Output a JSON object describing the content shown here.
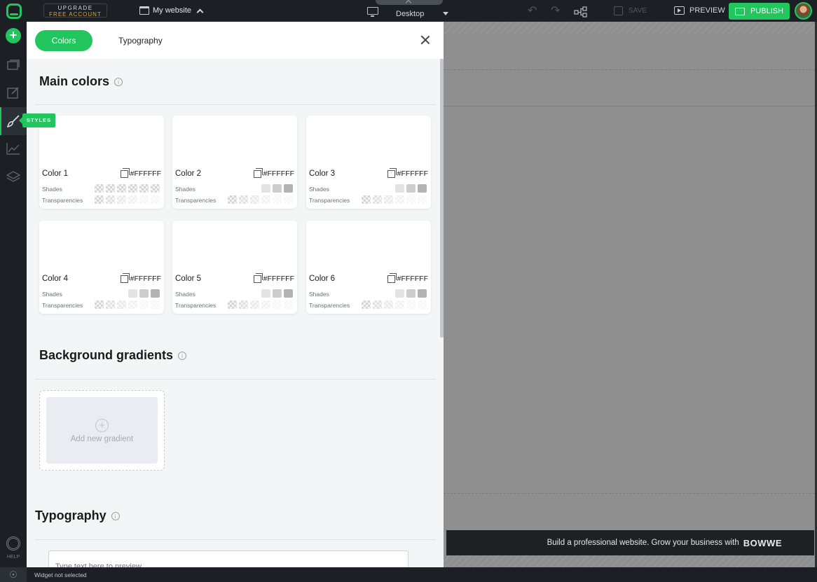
{
  "topbar": {
    "upgrade_line1": "UPGRADE",
    "upgrade_line2": "FREE ACCOUNT",
    "site_name": "My website",
    "device": "Desktop",
    "save_label": "SAVE",
    "preview_label": "PREVIEW",
    "publish_label": "PUBLISH"
  },
  "sidebar": {
    "styles_tooltip": "STYLES",
    "help_label": "HELP"
  },
  "panel": {
    "tabs": [
      "Colors",
      "Typography"
    ],
    "main_colors_title": "Main colors",
    "shades_label": "Shades",
    "transparencies_label": "Transparencies",
    "colors": [
      {
        "name": "Color 1",
        "hex": "#FFFFFF",
        "shades_transparent": true
      },
      {
        "name": "Color 2",
        "hex": "#FFFFFF",
        "shades_transparent": false
      },
      {
        "name": "Color 3",
        "hex": "#FFFFFF",
        "shades_transparent": false
      },
      {
        "name": "Color 4",
        "hex": "#FFFFFF",
        "shades_transparent": false
      },
      {
        "name": "Color 5",
        "hex": "#FFFFFF",
        "shades_transparent": false
      },
      {
        "name": "Color 6",
        "hex": "#FFFFFF",
        "shades_transparent": false
      }
    ],
    "gradients_title": "Background gradients",
    "add_gradient_label": "Add new gradient",
    "typography_title": "Typography",
    "preview_placeholder": "Type text here to preview"
  },
  "canvas": {
    "footer_text": "Build a professional website. Grow your business with",
    "footer_brand": "BOWWE"
  },
  "status": {
    "message": "Widget not selected"
  },
  "colors": {
    "accent": "#22c55e",
    "chrome": "#1c1f24"
  }
}
